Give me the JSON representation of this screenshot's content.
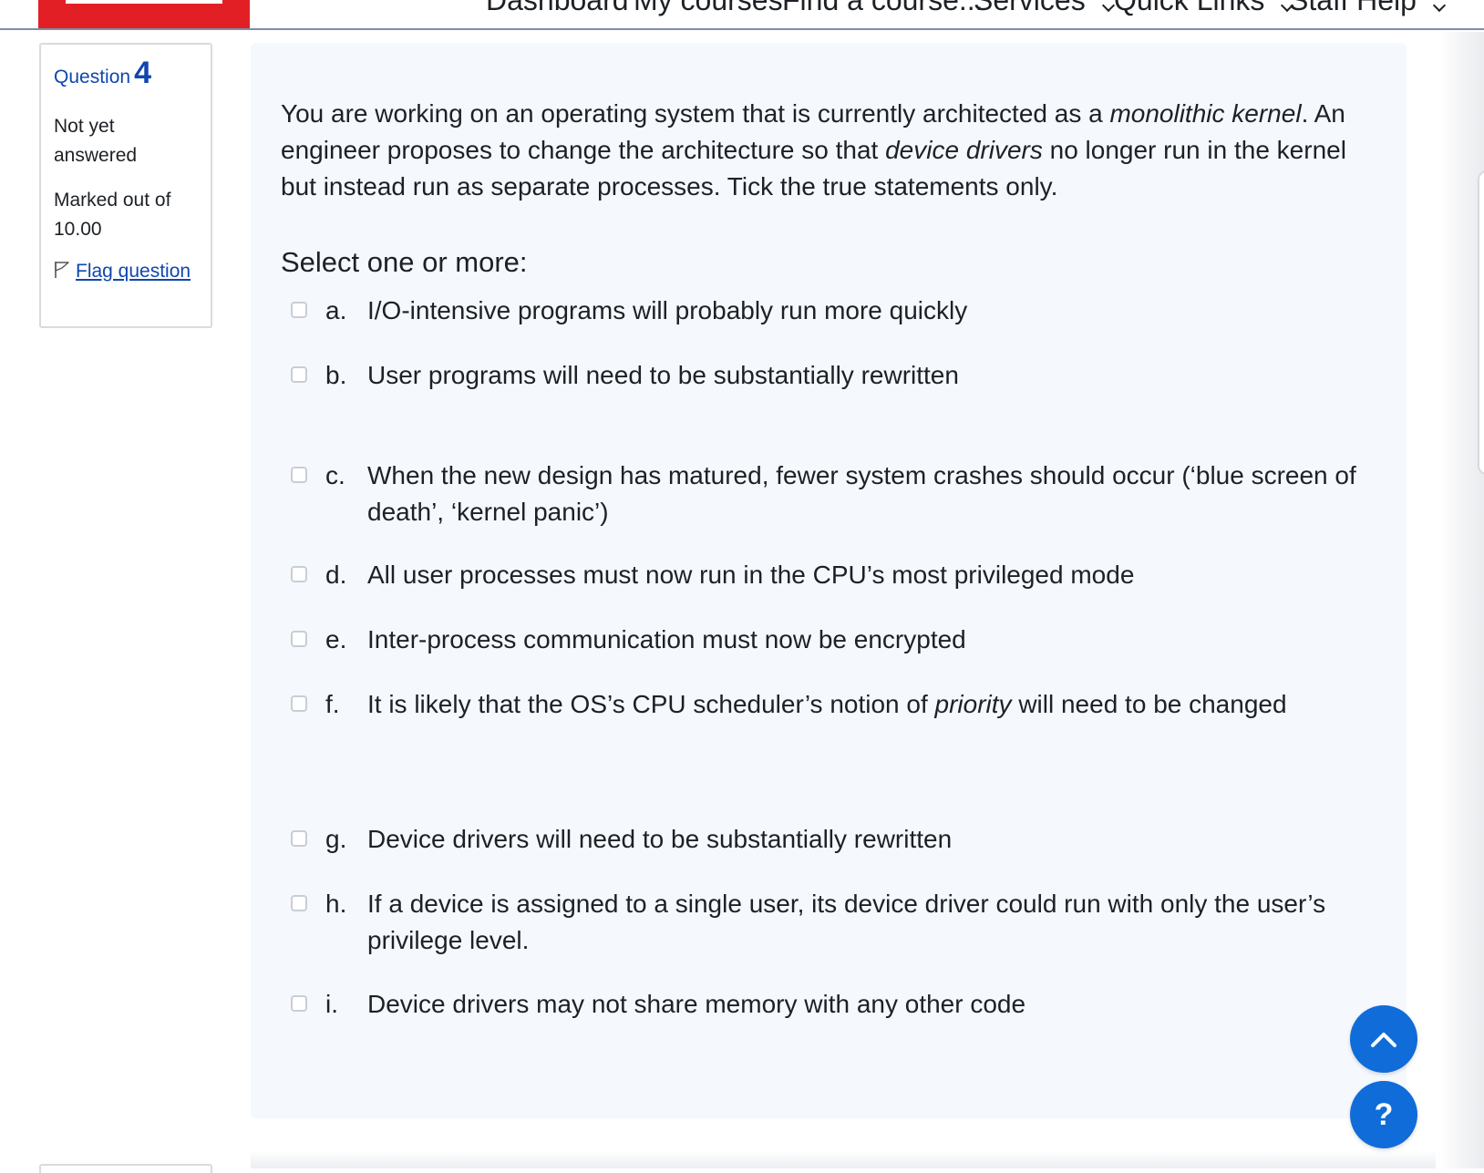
{
  "nav": {
    "items": [
      {
        "label": "Dashboard",
        "has_chevron": false
      },
      {
        "label": "My courses",
        "has_chevron": false
      },
      {
        "label": "Find a course...",
        "has_chevron": false
      },
      {
        "label": "Services",
        "has_chevron": true
      },
      {
        "label": "Quick Links",
        "has_chevron": true
      },
      {
        "label": "Staff Help",
        "has_chevron": true
      }
    ]
  },
  "question_info": {
    "label": "Question",
    "number": "4",
    "state": "Not yet answered",
    "grade": "Marked out of 10.00",
    "flag_label": "Flag question"
  },
  "question": {
    "text_parts": [
      {
        "text": "You are working on an operating system that is currently architected as a ",
        "italic": false
      },
      {
        "text": "monolithic kernel",
        "italic": true
      },
      {
        "text": ". An engineer proposes to change the architecture so that ",
        "italic": false
      },
      {
        "text": "device drivers",
        "italic": true
      },
      {
        "text": " no longer run in the kernel but instead run as separate processes. Tick the true statements only.",
        "italic": false
      }
    ],
    "prompt": "Select one or more:",
    "answers": [
      {
        "letter": "a.",
        "text": "I/O-intensive programs will probably run more quickly",
        "checked": false
      },
      {
        "letter": "b.",
        "text": "User programs will need to be substantially rewritten",
        "checked": false
      },
      {
        "letter": "c.",
        "text": "When the new design has matured, fewer system crashes should occur (‘blue screen of death’, ‘kernel panic’)",
        "checked": false
      },
      {
        "letter": "d.",
        "text": "All user processes must now run in the CPU’s most privileged mode",
        "checked": false
      },
      {
        "letter": "e.",
        "text": "Inter-process communication must now be encrypted",
        "checked": false
      },
      {
        "letter": "f.",
        "text_parts": [
          {
            "text": "It is likely that the OS’s CPU scheduler’s notion of ",
            "italic": false
          },
          {
            "text": "priority",
            "italic": true
          },
          {
            "text": " will need to be changed",
            "italic": false
          }
        ],
        "checked": false
      },
      {
        "letter": "g.",
        "text": "Device drivers will need to be substantially rewritten",
        "checked": false
      },
      {
        "letter": "h.",
        "text": "If a device is assigned to a single user, its device driver could run with only the user’s privilege level.",
        "checked": false
      },
      {
        "letter": "i.",
        "text": "Device drivers may not share memory with any other code",
        "checked": false
      }
    ]
  },
  "floating": {
    "up_icon": "chevron-up-icon",
    "help_label": "?"
  },
  "colors": {
    "brand_red": "#e31f26",
    "link_blue": "#0f47ad",
    "fab_blue": "#0f6cd9",
    "content_bg": "#f5f8fc"
  }
}
